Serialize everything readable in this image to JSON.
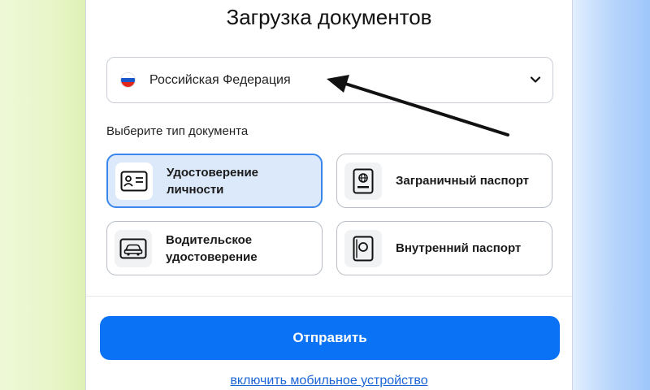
{
  "page": {
    "title": "Загрузка документов"
  },
  "country": {
    "selected": "Российская Федерация",
    "flag_colors": [
      "#ffffff",
      "#1c57c9",
      "#e1261c"
    ]
  },
  "document_types": {
    "label": "Выберите тип документа",
    "options": [
      {
        "line1": "Удостоверение",
        "line2": "личности",
        "icon": "id-card-icon",
        "selected": true
      },
      {
        "line1": "Заграничный паспорт",
        "line2": "",
        "icon": "passport-icon",
        "selected": false
      },
      {
        "line1": "Водительское",
        "line2": "удостоверение",
        "icon": "car-icon",
        "selected": false
      },
      {
        "line1": "Внутренний паспорт",
        "line2": "",
        "icon": "internal-passport-icon",
        "selected": false
      }
    ]
  },
  "actions": {
    "submit_label": "Отправить",
    "mobile_link_label": "включить мобильное устройство"
  },
  "colors": {
    "accent": "#0a72f5",
    "selected_card_bg": "#dce9fb",
    "selected_card_border": "#3b86ec",
    "link": "#1a64d6"
  }
}
